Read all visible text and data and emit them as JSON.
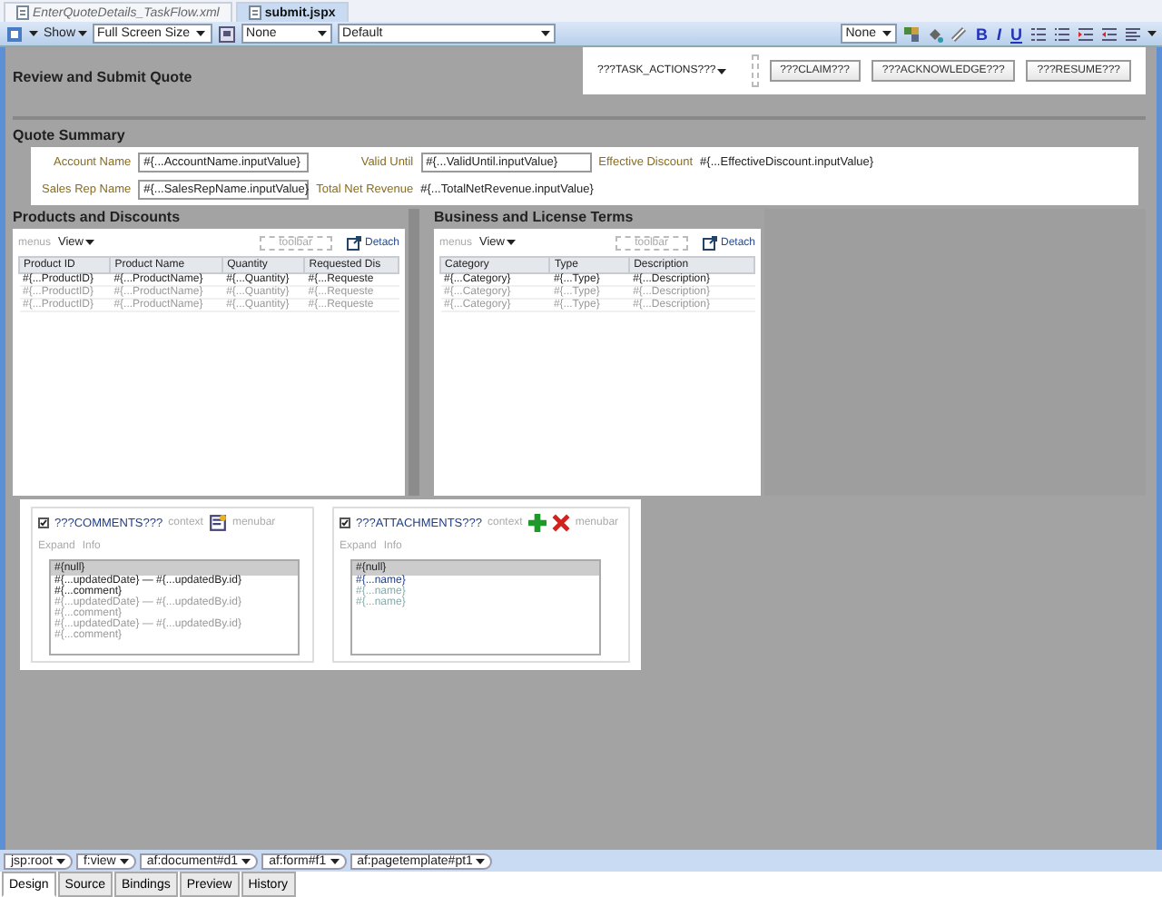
{
  "editor_tabs": [
    {
      "label": "EnterQuoteDetails_TaskFlow.xml",
      "selected": false
    },
    {
      "label": "submit.jspx",
      "selected": true
    }
  ],
  "toolbar": {
    "show": "Show",
    "size": "Full Screen Size",
    "region": "None",
    "style": "Default",
    "font": "None",
    "format": [
      "B",
      "I",
      "U"
    ]
  },
  "page": {
    "title": "Review and Submit Quote",
    "task_actions": {
      "menu": "???TASK_ACTIONS???",
      "buttons": [
        "???CLAIM???",
        "???ACKNOWLEDGE???",
        "???RESUME???"
      ]
    },
    "quote_summary": {
      "title": "Quote Summary",
      "fields": [
        {
          "label": "Account Name",
          "value": "#{...AccountName.inputValue}",
          "kind": "input"
        },
        {
          "label": "Sales Rep Name",
          "value": "#{...SalesRepName.inputValue}",
          "kind": "input"
        },
        {
          "label": "Valid Until",
          "value": "#{...ValidUntil.inputValue}",
          "kind": "input"
        },
        {
          "label": "Total Net Revenue",
          "value": "#{...TotalNetRevenue.inputValue}",
          "kind": "text"
        },
        {
          "label": "Effective Discount",
          "value": "#{...EffectiveDiscount.inputValue}",
          "kind": "text"
        }
      ]
    },
    "tables": [
      {
        "title": "Products and Discounts",
        "menus": "menus",
        "view": "View",
        "toolbar": "toolbar",
        "detach": "Detach",
        "columns": [
          "Product ID",
          "Product Name",
          "Quantity",
          "Requested Dis"
        ],
        "rows": [
          {
            "dimmed": false,
            "cells": [
              "#{...ProductID}",
              "#{...ProductName}",
              "#{...Quantity}",
              "#{...Requeste"
            ]
          },
          {
            "dimmed": true,
            "cells": [
              "#{...ProductID}",
              "#{...ProductName}",
              "#{...Quantity}",
              "#{...Requeste"
            ]
          },
          {
            "dimmed": true,
            "cells": [
              "#{...ProductID}",
              "#{...ProductName}",
              "#{...Quantity}",
              "#{...Requeste"
            ]
          }
        ]
      },
      {
        "title": "Business and License Terms",
        "menus": "menus",
        "view": "View",
        "toolbar": "toolbar",
        "detach": "Detach",
        "columns": [
          "Category",
          "Type",
          "Description"
        ],
        "rows": [
          {
            "dimmed": false,
            "cells": [
              "#{...Category}",
              "#{...Type}",
              "#{...Description}"
            ]
          },
          {
            "dimmed": true,
            "cells": [
              "#{...Category}",
              "#{...Type}",
              "#{...Description}"
            ]
          },
          {
            "dimmed": true,
            "cells": [
              "#{...Category}",
              "#{...Type}",
              "#{...Description}"
            ]
          }
        ]
      }
    ],
    "boxes": [
      {
        "title": "???COMMENTS???",
        "context": "context",
        "menubar": "menubar",
        "expand": "Expand",
        "info": "Info",
        "header": "#{null}",
        "kind": "comments",
        "items": [
          {
            "dimmed": false,
            "text": "#{...updatedDate}  —  #{...updatedBy.id}"
          },
          {
            "dimmed": false,
            "text": "#{...comment}"
          },
          {
            "dimmed": true,
            "text": "#{...updatedDate}  —  #{...updatedBy.id}"
          },
          {
            "dimmed": true,
            "text": "#{...comment}"
          },
          {
            "dimmed": true,
            "text": "#{...updatedDate}  —  #{...updatedBy.id}"
          },
          {
            "dimmed": true,
            "text": "#{...comment}"
          }
        ]
      },
      {
        "title": "???ATTACHMENTS???",
        "context": "context",
        "menubar": "menubar",
        "expand": "Expand",
        "info": "Info",
        "header": "#{null}",
        "kind": "attachments",
        "items": [
          {
            "dimmed": false,
            "text": "#{...name}"
          },
          {
            "dimmed": true,
            "text": "#{...name}"
          },
          {
            "dimmed": true,
            "text": "#{...name}"
          }
        ]
      }
    ]
  },
  "breadcrumb": [
    "jsp:root",
    "f:view",
    "af:document#d1",
    "af:form#f1",
    "af:pagetemplate#pt1"
  ],
  "bottom_tabs": [
    {
      "label": "Design",
      "selected": true
    },
    {
      "label": "Source",
      "selected": false
    },
    {
      "label": "Bindings",
      "selected": false
    },
    {
      "label": "Preview",
      "selected": false
    },
    {
      "label": "History",
      "selected": false
    }
  ]
}
